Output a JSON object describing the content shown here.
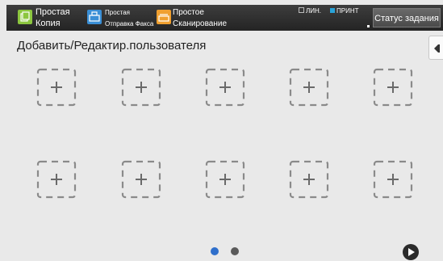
{
  "topbar": {
    "apps": [
      {
        "id": "easy-copy",
        "icon": "copy-icon",
        "lines": [
          "Простая",
          "Копия"
        ]
      },
      {
        "id": "easy-fax",
        "icon": "fax-icon",
        "lines": [
          "Простая",
          "Отправка Факса"
        ]
      },
      {
        "id": "easy-scan",
        "icon": "scan-icon",
        "lines": [
          "Простое",
          "Сканирование"
        ]
      }
    ],
    "indicators": {
      "line": "ЛИН.",
      "print": "ПРИНТ"
    },
    "job_status_label": "Статус задания"
  },
  "page": {
    "title": "Добавить/Редактир.пользователя"
  },
  "slots": {
    "count": 10,
    "icon": "add-plus-icon"
  },
  "pagination": {
    "pages": 2,
    "current": 1
  },
  "colors": {
    "accent": "#2f6fcb",
    "copy": "#8cc63f",
    "fax": "#3a8fd6",
    "scan": "#f0a030",
    "indicator_print": "#29a3d8"
  }
}
